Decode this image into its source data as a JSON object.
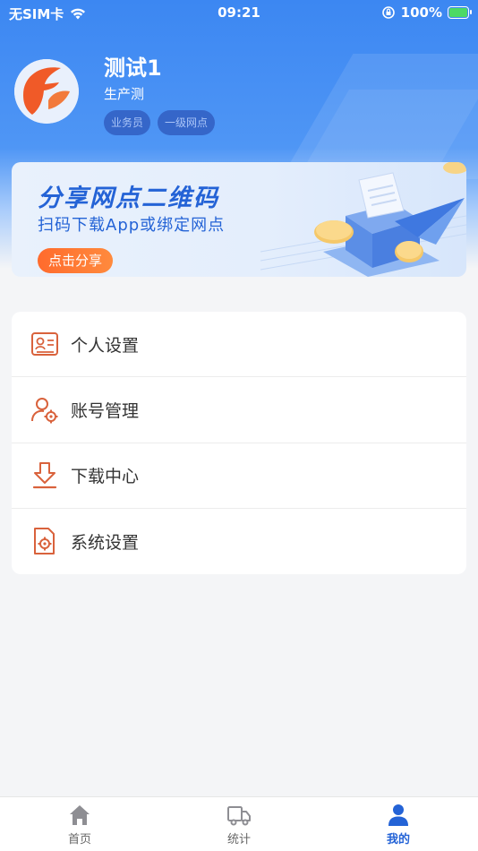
{
  "status_bar": {
    "carrier": "无SIM卡",
    "time": "09:21",
    "battery": "100%"
  },
  "profile": {
    "name": "测试1",
    "org": "生产测",
    "tags": [
      "业务员",
      "一级网点"
    ]
  },
  "banner": {
    "title": "分享网点二维码",
    "subtitle": "扫码下载App或绑定网点",
    "button": "点击分享"
  },
  "menu": {
    "items": [
      {
        "label": "个人设置",
        "icon": "id-card-icon"
      },
      {
        "label": "账号管理",
        "icon": "user-gear-icon"
      },
      {
        "label": "下载中心",
        "icon": "download-icon"
      },
      {
        "label": "系统设置",
        "icon": "document-gear-icon"
      }
    ]
  },
  "tab_bar": {
    "tabs": [
      {
        "label": "首页",
        "icon": "home-icon"
      },
      {
        "label": "统计",
        "icon": "truck-icon"
      },
      {
        "label": "我的",
        "icon": "person-icon",
        "active": true
      }
    ]
  },
  "colors": {
    "brand_blue": "#2463d6",
    "accent_orange": "#ff6b2d",
    "icon_orange": "#d9623c"
  }
}
